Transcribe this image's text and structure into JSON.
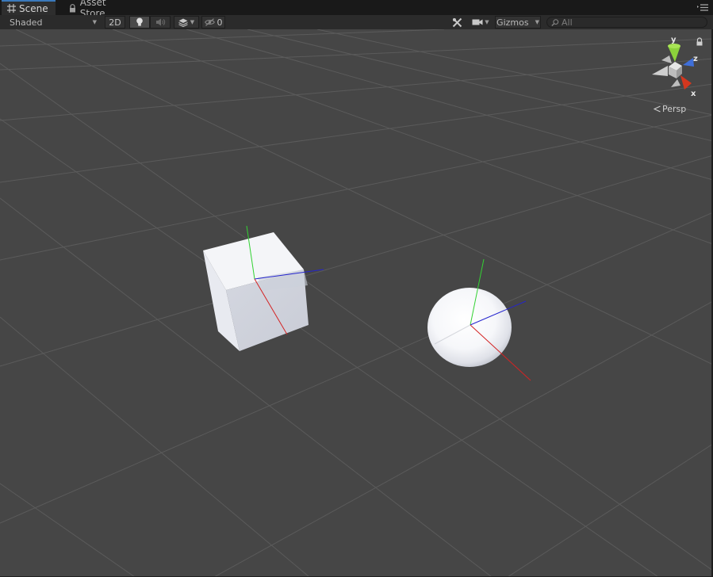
{
  "window": {
    "tabs": [
      {
        "label": "Scene",
        "icon": "scene-grid-icon",
        "active": true
      },
      {
        "label": "Asset Store",
        "icon": "lock-icon",
        "active": false
      }
    ],
    "menu_icon": "tab-menu-icon"
  },
  "toolbar": {
    "shading_mode": "Shaded",
    "mode_2d_label": "2D",
    "lighting_icon": "lightbulb-icon",
    "audio_icon": "speaker-icon",
    "effects_icon": "layers-icon",
    "hidden_count": "0",
    "hidden_icon": "eye-slash-icon",
    "tools_icon": "tools-icon",
    "camera_icon": "camera-icon",
    "gizmos_label": "Gizmos",
    "search_placeholder": "All",
    "search_value": ""
  },
  "viewport": {
    "projection_label": "Persp",
    "axis_labels": {
      "y": "y",
      "z": "z",
      "x": "x"
    },
    "colors": {
      "background": "#464646",
      "grid": "#5a5a5a",
      "axis_x": "#d42323",
      "axis_y": "#33d233",
      "axis_z": "#2424ce",
      "gizmo_y": "#8cd13b",
      "gizmo_z": "#3f6fd9",
      "gizmo_x": "#d4371f"
    },
    "objects": [
      {
        "name": "Cube",
        "shape": "cube"
      },
      {
        "name": "Sphere",
        "shape": "sphere"
      }
    ]
  }
}
